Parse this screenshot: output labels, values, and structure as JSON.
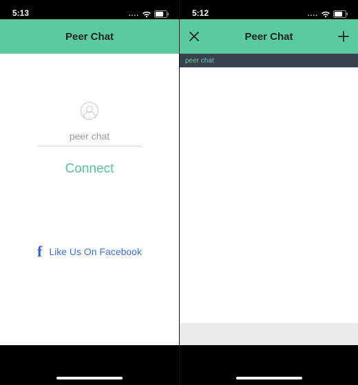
{
  "colors": {
    "accent": "#5bcaa0",
    "accent_text": "#53c59a",
    "fb": "#3b6fe0"
  },
  "screen_a": {
    "status_time": "5:13",
    "app_title": "Peer Chat",
    "username_value": "peer chat",
    "connect_label": "Connect",
    "facebook_label": "Like Us On Facebook"
  },
  "screen_b": {
    "status_time": "5:12",
    "app_title": "Peer Chat",
    "subbar_label": "peer chat"
  }
}
